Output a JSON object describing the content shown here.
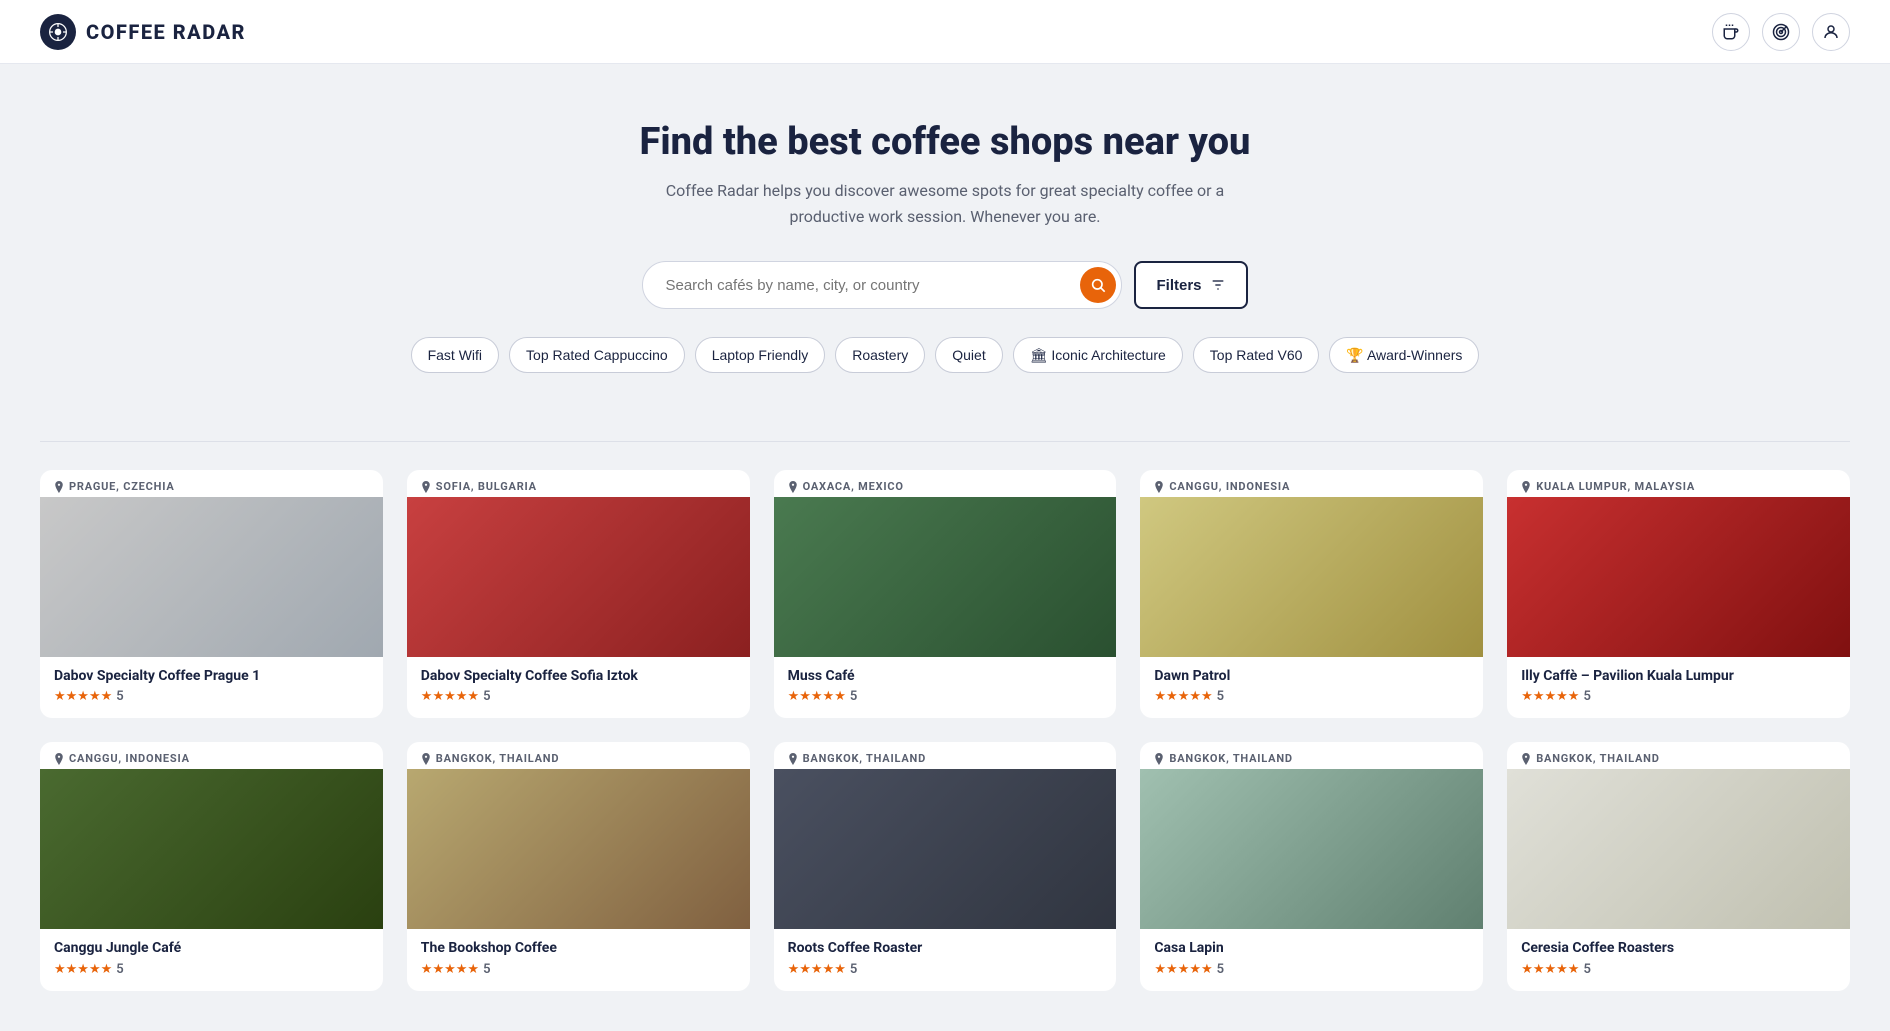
{
  "nav": {
    "logo_text": "COFFEE RADAR",
    "logo_icon": "☕",
    "icons": [
      "☕",
      "📡",
      "👤"
    ]
  },
  "hero": {
    "title": "Find the best coffee shops near you",
    "subtitle": "Coffee Radar helps you discover awesome spots for great specialty coffee or a productive work session. Whenever you are.",
    "search_placeholder": "Search cafés by name, city, or country",
    "search_button_icon": "🔍",
    "filters_label": "Filters",
    "filters_icon": "⚙"
  },
  "filter_tags": [
    {
      "label": "Fast Wifi",
      "icon": ""
    },
    {
      "label": "Top Rated Cappuccino",
      "icon": ""
    },
    {
      "label": "Laptop Friendly",
      "icon": ""
    },
    {
      "label": "Roastery",
      "icon": ""
    },
    {
      "label": "Quiet",
      "icon": ""
    },
    {
      "label": "Iconic Architecture",
      "icon": "🏛"
    },
    {
      "label": "Top Rated V60",
      "icon": ""
    },
    {
      "label": "Award-Winners",
      "icon": "🏆"
    }
  ],
  "cafes": [
    {
      "location": "Prague, Czechia",
      "name": "Dabov Specialty Coffee Prague 1",
      "rating": "5",
      "stars": 5,
      "img_class": "img-prague"
    },
    {
      "location": "Sofia, Bulgaria",
      "name": "Dabov Specialty Coffee Sofia Iztok",
      "rating": "5",
      "stars": 5,
      "img_class": "img-sofia"
    },
    {
      "location": "Oaxaca, Mexico",
      "name": "Muss Café",
      "rating": "5",
      "stars": 5,
      "img_class": "img-oaxaca"
    },
    {
      "location": "Canggu, Indonesia",
      "name": "Dawn Patrol",
      "rating": "5",
      "stars": 5,
      "img_class": "img-canggu"
    },
    {
      "location": "Kuala Lumpur, Malaysia",
      "name": "Illy Caffè – Pavilion Kuala Lumpur",
      "rating": "5",
      "stars": 5,
      "img_class": "img-kl"
    },
    {
      "location": "Canggu, Indonesia",
      "name": "Canggu Jungle Café",
      "rating": "5",
      "stars": 5,
      "img_class": "img-canggu2"
    },
    {
      "location": "Bangkok, Thailand",
      "name": "The Bookshop Coffee",
      "rating": "5",
      "stars": 5,
      "img_class": "img-bangkok1"
    },
    {
      "location": "Bangkok, Thailand",
      "name": "Roots Coffee Roaster",
      "rating": "5",
      "stars": 5,
      "img_class": "img-bangkok2"
    },
    {
      "location": "Bangkok, Thailand",
      "name": "Casa Lapin",
      "rating": "5",
      "stars": 5,
      "img_class": "img-bangkok3"
    },
    {
      "location": "Bangkok, Thailand",
      "name": "Ceresia Coffee Roasters",
      "rating": "5",
      "stars": 5,
      "img_class": "img-bangkok4"
    }
  ]
}
